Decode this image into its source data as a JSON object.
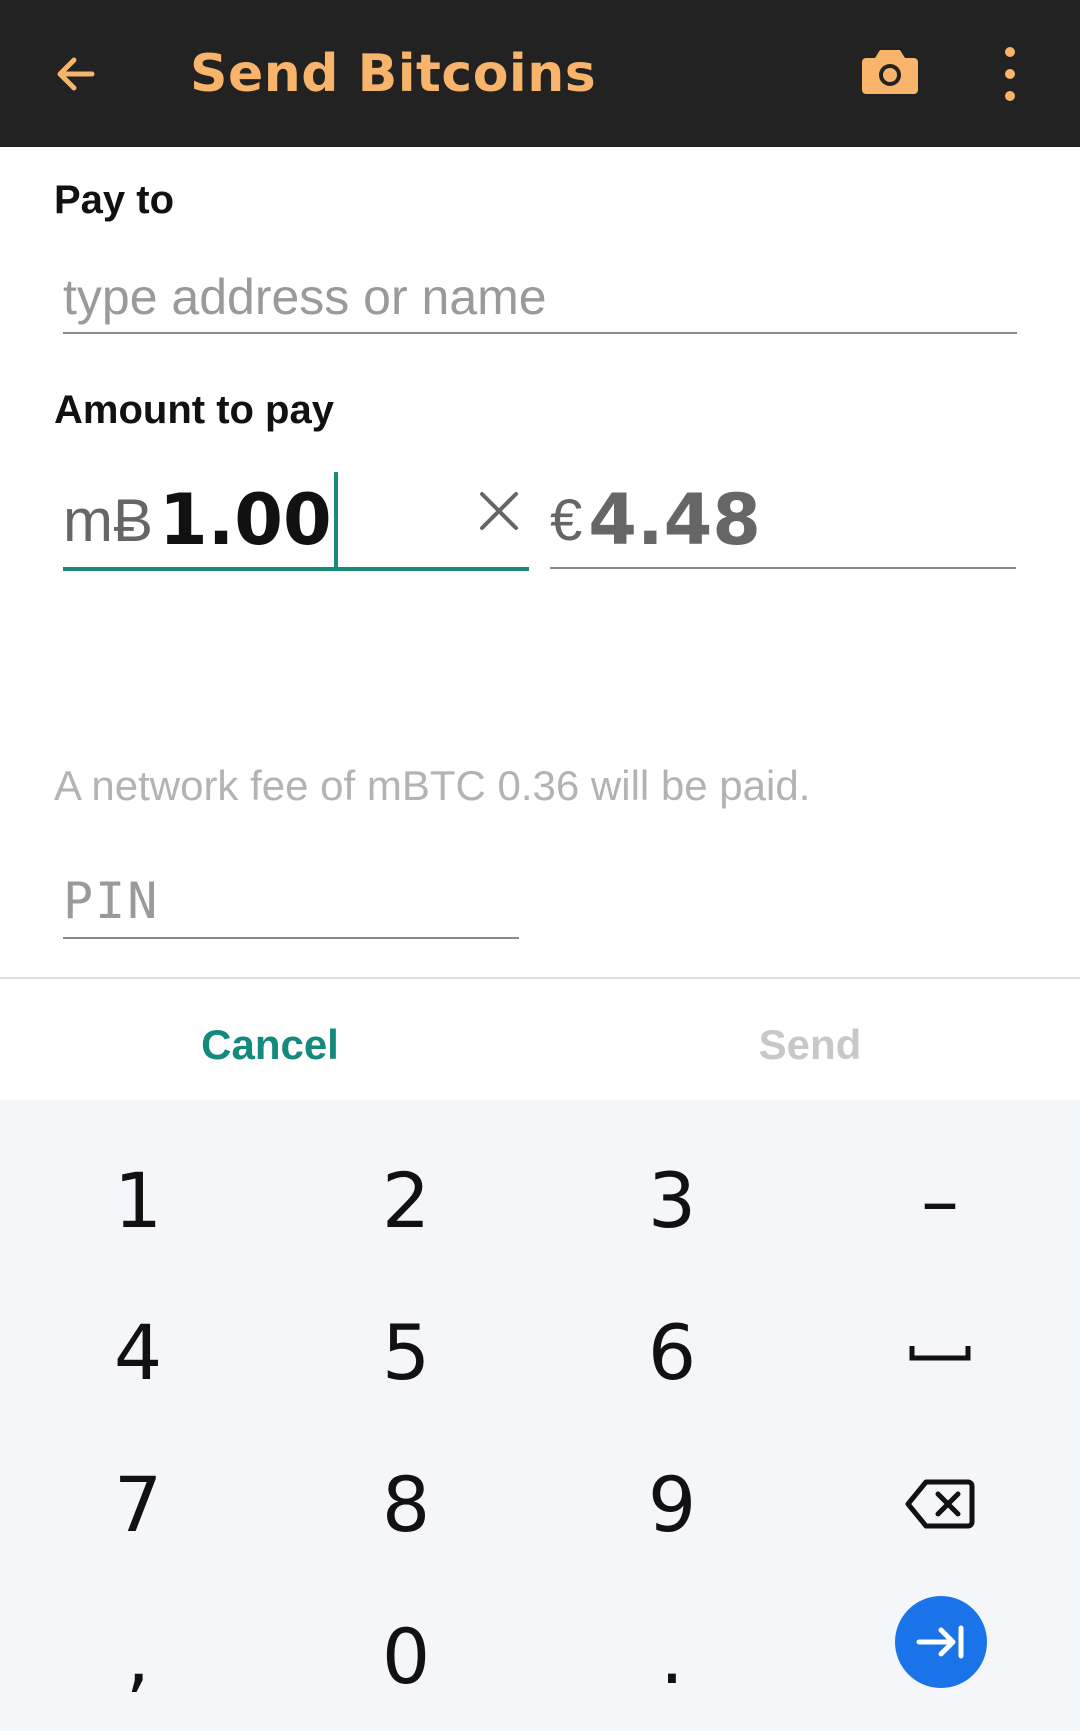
{
  "appbar": {
    "title": "Send Bitcoins",
    "icons": {
      "back": "arrow-left-icon",
      "camera": "camera-icon",
      "more": "more-vert-icon"
    },
    "title_color": "#f7b46a",
    "background": "#222222"
  },
  "pay_to": {
    "label": "Pay to",
    "placeholder": "type address or name"
  },
  "amount": {
    "label": "Amount to pay",
    "btc_currency": "mɃ",
    "btc_value": "1.00",
    "fiat_currency": "€",
    "fiat_value": "4.48",
    "accent": "#1a8a7a"
  },
  "fee_text": "A network fee of mBTC 0.36 will be paid.",
  "pin": {
    "placeholder": "PIN"
  },
  "buttons": {
    "cancel": "Cancel",
    "send": "Send"
  },
  "keyboard": {
    "rows": [
      [
        "1",
        "2",
        "3",
        "–"
      ],
      [
        "4",
        "5",
        "6",
        "space-icon"
      ],
      [
        "7",
        "8",
        "9",
        "backspace-icon"
      ],
      [
        ",",
        "0",
        ".",
        "enter-icon"
      ]
    ],
    "enter_color": "#1a73e8"
  }
}
